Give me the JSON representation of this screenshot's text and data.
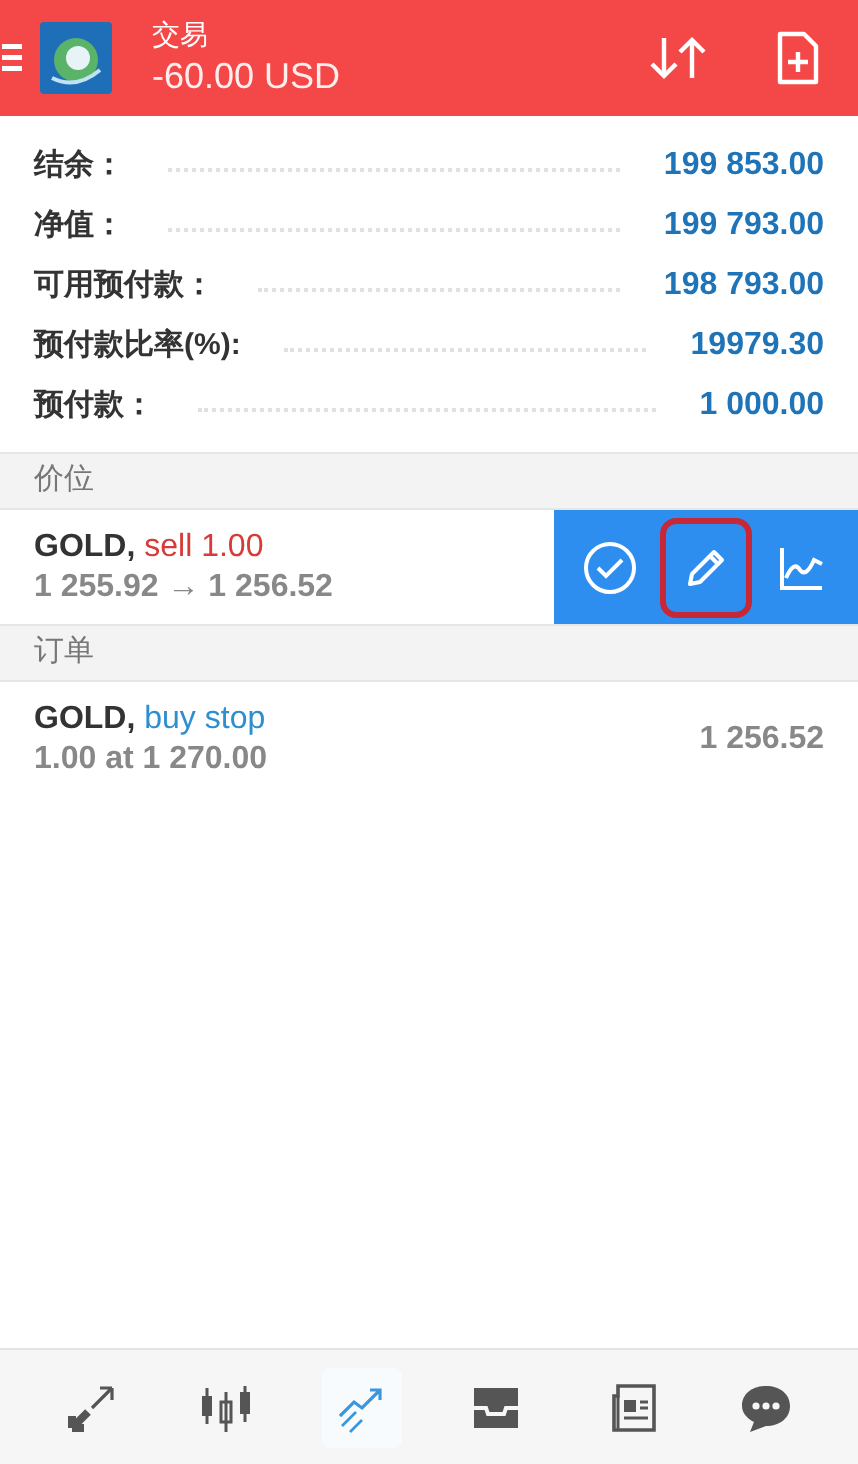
{
  "header": {
    "title": "交易",
    "balance": "-60.00 USD"
  },
  "summary": [
    {
      "label": "结余：",
      "value": "199 853.00"
    },
    {
      "label": "净值：",
      "value": "199 793.00"
    },
    {
      "label": "可用预付款：",
      "value": "198 793.00"
    },
    {
      "label": "预付款比率(%):",
      "value": "19979.30"
    },
    {
      "label": "预付款：",
      "value": "1 000.00"
    }
  ],
  "sections": [
    {
      "title": "价位",
      "items": [
        {
          "symbol": "GOLD,",
          "action": "sell 1.00",
          "kind": "sell",
          "detail": "1 255.92 → 1 256.52",
          "actions": [
            {
              "kind": "close",
              "highlighted": false
            },
            {
              "kind": "edit",
              "highlighted": true
            },
            {
              "kind": "chart",
              "highlighted": false
            }
          ]
        }
      ]
    },
    {
      "title": "订单",
      "items": [
        {
          "symbol": "GOLD,",
          "action": "buy stop",
          "kind": "buy",
          "detail": "1.00 at 1 270.00",
          "price": "1 256.52"
        }
      ]
    }
  ],
  "nav": [
    {
      "kind": "quotes",
      "selected": false
    },
    {
      "kind": "chart",
      "selected": false
    },
    {
      "kind": "trade",
      "selected": true
    },
    {
      "kind": "inbox",
      "selected": false
    },
    {
      "kind": "news",
      "selected": false
    },
    {
      "kind": "chat",
      "selected": false
    }
  ]
}
